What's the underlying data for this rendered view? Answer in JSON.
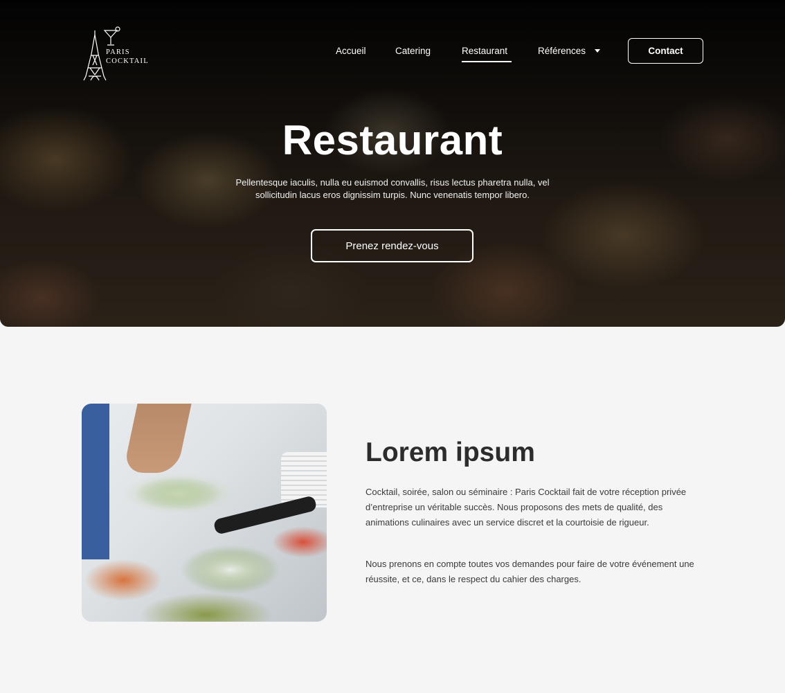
{
  "brand": {
    "line1": "PARIS",
    "line2": "COCKTAIL"
  },
  "nav": {
    "items": [
      {
        "label": "Accueil"
      },
      {
        "label": "Catering"
      },
      {
        "label": "Restaurant",
        "active": true
      },
      {
        "label": "Références",
        "has_dropdown": true
      }
    ],
    "contact_label": "Contact"
  },
  "hero": {
    "title": "Restaurant",
    "text": "Pellentesque iaculis, nulla eu euismod convallis, risus lectus pharetra nulla, vel sollicitudin lacus eros dignissim turpis. Nunc venenatis tempor libero.",
    "cta_label": "Prenez rendez-vous"
  },
  "about": {
    "title": "Lorem ipsum",
    "paragraph1": "Cocktail, soirée, salon ou séminaire : Paris Cocktail fait de votre réception privée d’entreprise un véritable succès. Nous proposons des mets de qualité, des animations culinaires avec un service discret et la courtoisie de rigueur.",
    "paragraph2": "Nous prenons en compte toutes vos demandes pour faire de votre événement une réussite, et ce, dans le respect du cahier des charges."
  },
  "icons": {
    "logo": "eiffel-tower-cocktail-logo-icon",
    "dropdown": "caret-down-icon"
  },
  "colors": {
    "background": "#f5f5f5",
    "text_dark": "#2c2c2c",
    "hero_text": "#ffffff"
  }
}
